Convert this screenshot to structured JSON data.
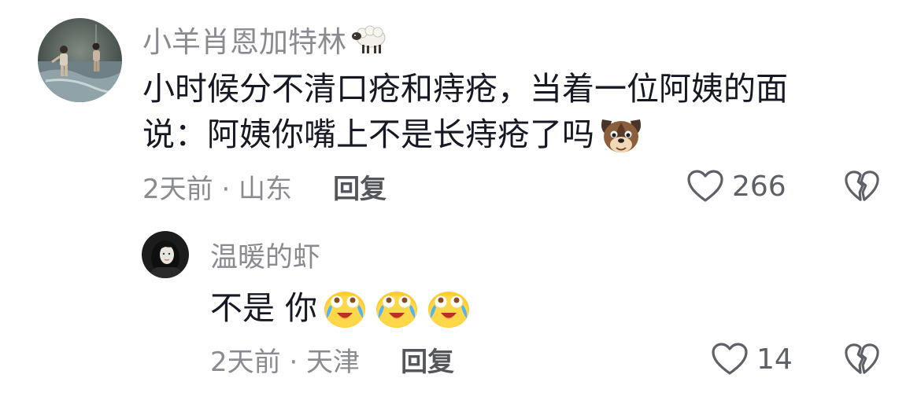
{
  "comment": {
    "username": "小羊肖恩加特林",
    "username_emoji": "sheep-icon",
    "text_line1": "小时候分不清口疮和痔疮，当着一位阿姨的面",
    "text_line2": "说：阿姨你嘴上不是长痔疮了吗",
    "text_emoji": "dog-face-emoji",
    "time_location": "2天前 · 山东",
    "reply_label": "回复",
    "like_count": "266"
  },
  "reply": {
    "username": "温暖的虾",
    "text": "不是 你",
    "text_emojis": [
      "crying-laugh-emoji",
      "crying-laugh-emoji",
      "crying-laugh-emoji"
    ],
    "time_location": "2天前 · 天津",
    "reply_label": "回复",
    "like_count": "14"
  },
  "icons": {
    "like": "heart-outline-icon",
    "dislike": "broken-heart-icon"
  },
  "colors": {
    "primary_text": "#161823",
    "secondary_text": "#8a8b91",
    "icon": "#5e6068"
  }
}
